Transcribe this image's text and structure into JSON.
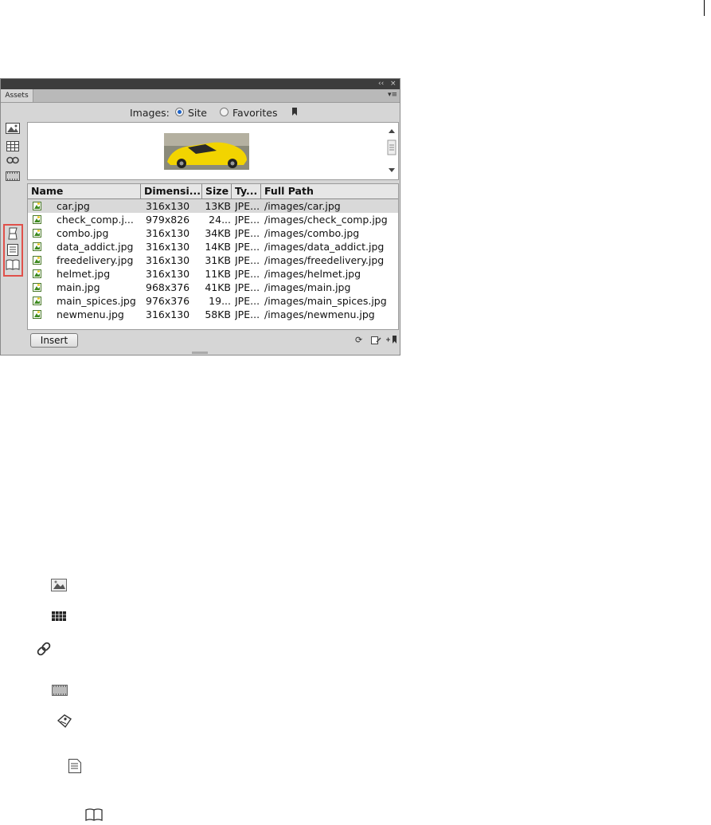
{
  "panel": {
    "title_controls": {
      "collapse": "‹‹",
      "close": "×"
    },
    "tab_label": "Assets",
    "tab_menu": "▾≡",
    "images_label": "Images:",
    "radio_site": "Site",
    "radio_favorites": "Favorites",
    "favorites_selected": false,
    "site_selected": true
  },
  "sidebar_icons": [
    "images-icon",
    "colors-icon",
    "urls-icon",
    "media-icon",
    "templates-icon",
    "library-icon",
    "snippets-icon"
  ],
  "table": {
    "columns": [
      "Name",
      "Dimensi...",
      "Size",
      "Ty...",
      "Full Path"
    ],
    "rows": [
      {
        "name": "car.jpg",
        "dim": "316x130",
        "size": "13KB",
        "type": "JPE...",
        "path": "/images/car.jpg"
      },
      {
        "name": "check_comp.j...",
        "dim": "979x826",
        "size": "24...",
        "type": "JPE...",
        "path": "/images/check_comp.jpg"
      },
      {
        "name": "combo.jpg",
        "dim": "316x130",
        "size": "34KB",
        "type": "JPE...",
        "path": "/images/combo.jpg"
      },
      {
        "name": "data_addict.jpg",
        "dim": "316x130",
        "size": "14KB",
        "type": "JPE...",
        "path": "/images/data_addict.jpg"
      },
      {
        "name": "freedelivery.jpg",
        "dim": "316x130",
        "size": "31KB",
        "type": "JPE...",
        "path": "/images/freedelivery.jpg"
      },
      {
        "name": "helmet.jpg",
        "dim": "316x130",
        "size": "11KB",
        "type": "JPE...",
        "path": "/images/helmet.jpg"
      },
      {
        "name": "main.jpg",
        "dim": "968x376",
        "size": "41KB",
        "type": "JPE...",
        "path": "/images/main.jpg"
      },
      {
        "name": "main_spices.jpg",
        "dim": "976x376",
        "size": "19...",
        "type": "JPE...",
        "path": "/images/main_spices.jpg"
      },
      {
        "name": "newmenu.jpg",
        "dim": "316x130",
        "size": "58KB",
        "type": "JPE...",
        "path": "/images/newmenu.jpg"
      }
    ],
    "selected_row": 0
  },
  "bottom": {
    "insert_label": "Insert"
  },
  "legend_icons": [
    "image-icon",
    "table-grid-icon",
    "link-icon",
    "film-icon",
    "tag-icon",
    "document-icon",
    "book-icon"
  ]
}
